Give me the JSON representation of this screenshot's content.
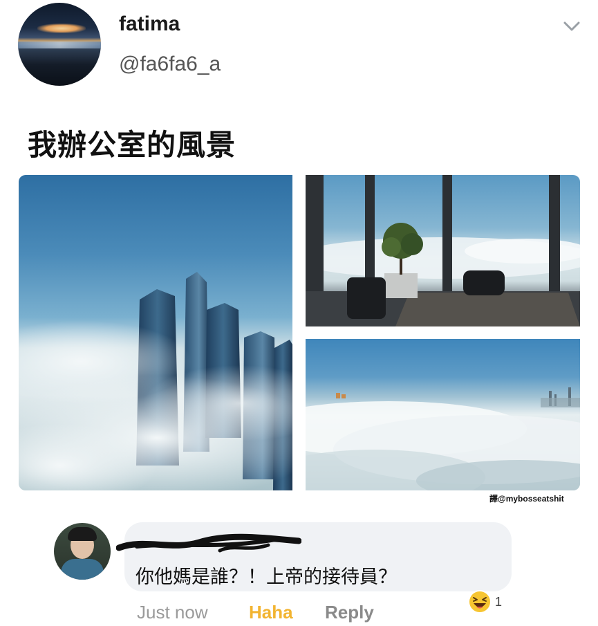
{
  "post": {
    "author": {
      "display_name": "fatima",
      "handle": "@fa6fa6_a",
      "avatar_icon": "sunset-sky-avatar"
    },
    "menu_icon": "chevron-down-icon",
    "text": "我辦公室的風景",
    "photos": [
      {
        "name": "skyscrapers-above-clouds-photo"
      },
      {
        "name": "office-window-cloud-view-photo"
      },
      {
        "name": "sea-of-clouds-photo"
      }
    ],
    "watermark": "譯@mybosseatshit"
  },
  "comment": {
    "author_redacted": true,
    "text": "你他媽是誰？！上帝的接待員？",
    "time": "Just now",
    "actions": {
      "haha": "Haha",
      "reply": "Reply"
    },
    "reaction": {
      "icon": "laughing-emoji-icon",
      "count": "1"
    }
  },
  "colors": {
    "haha_accent": "#f2b431",
    "bubble_bg": "#f0f2f5"
  }
}
